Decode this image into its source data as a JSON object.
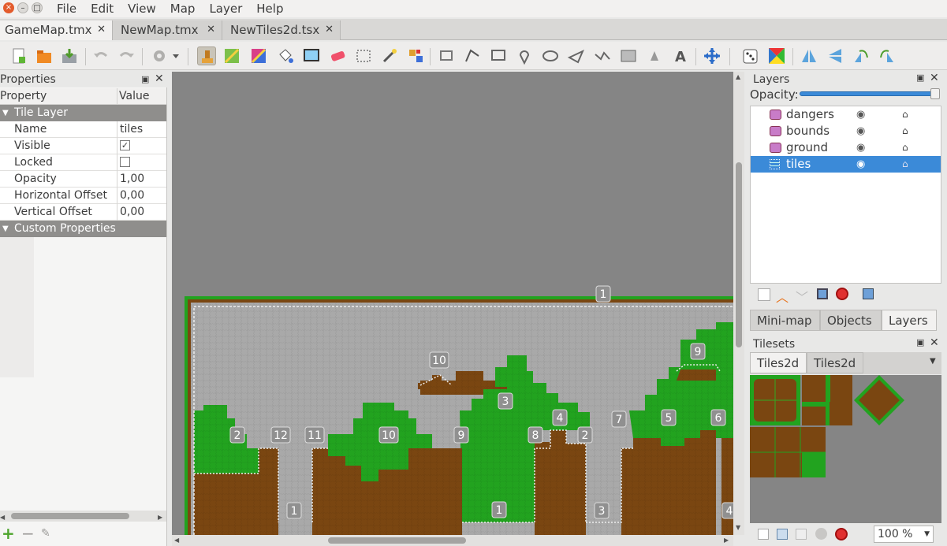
{
  "window": {
    "close": "×",
    "minimize": "–",
    "maximize": "□"
  },
  "menu": [
    "File",
    "Edit",
    "View",
    "Map",
    "Layer",
    "Help"
  ],
  "tabs": [
    {
      "label": "GameMap.tmx",
      "close": "✕"
    },
    {
      "label": "NewMap.tmx",
      "close": "✕"
    },
    {
      "label": "NewTiles2d.tsx",
      "close": "✕"
    }
  ],
  "properties": {
    "title": "Properties",
    "col_property": "Property",
    "col_value": "Value",
    "group_tile_layer": "Tile Layer",
    "group_custom": "Custom Properties",
    "rows": [
      {
        "key": "Name",
        "value": "tiles"
      },
      {
        "key": "Visible",
        "value": "✓"
      },
      {
        "key": "Locked",
        "value": ""
      },
      {
        "key": "Opacity",
        "value": "1,00"
      },
      {
        "key": "Horizontal Offset",
        "value": "0,00"
      },
      {
        "key": "Vertical Offset",
        "value": "0,00"
      }
    ]
  },
  "layers_panel": {
    "title": "Layers",
    "opacity_label": "Opacity:",
    "opacity_value": 1.0,
    "layers": [
      {
        "name": "dangers",
        "selected": false
      },
      {
        "name": "bounds",
        "selected": false
      },
      {
        "name": "ground",
        "selected": false
      },
      {
        "name": "tiles",
        "selected": true
      }
    ],
    "tabs": [
      "Mini-map",
      "Objects",
      "Layers"
    ]
  },
  "tilesets_panel": {
    "title": "Tilesets",
    "tabs": [
      "Tiles2d",
      "Tiles2d"
    ],
    "zoom": "100 %"
  },
  "map_labels": [
    "1",
    "10",
    "9",
    "3",
    "4",
    "7",
    "5",
    "6",
    "1",
    "12",
    "11",
    "2",
    "10",
    "9",
    "8",
    "2",
    "1",
    "3",
    "4"
  ],
  "colors": {
    "grass": "#22a31f",
    "dirt": "#7a4611",
    "sky": "#a9a9a9",
    "bg": "#858585",
    "selection": "#3b8ad8"
  }
}
